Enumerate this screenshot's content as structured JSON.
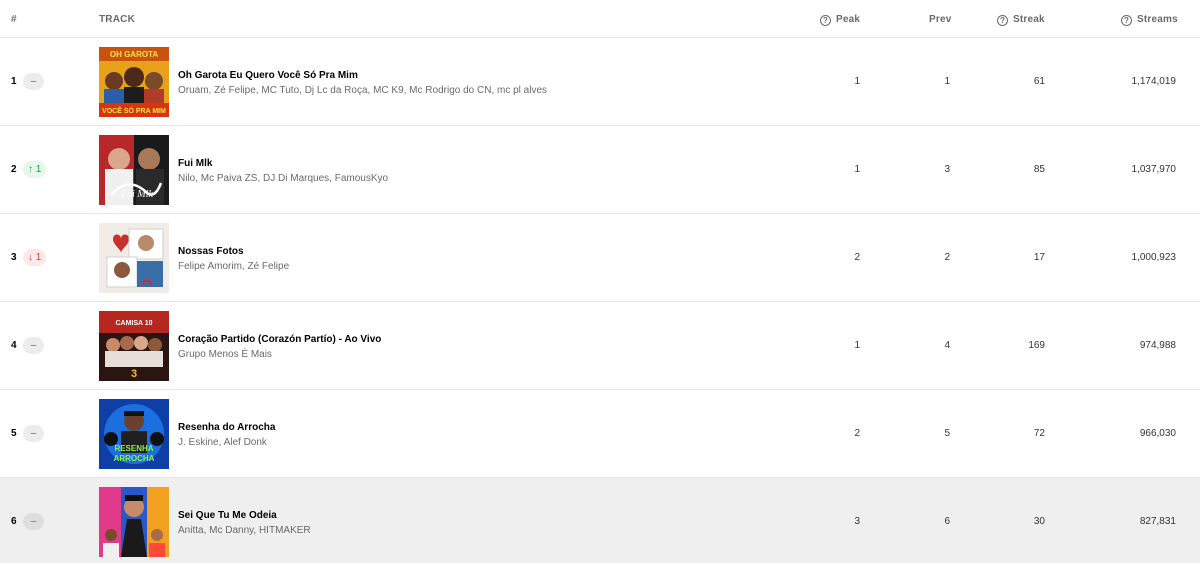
{
  "header": {
    "rank": "#",
    "track": "TRACK",
    "peak": "Peak",
    "prev": "Prev",
    "streak": "Streak",
    "streams": "Streams",
    "help_icon": "?"
  },
  "rows": [
    {
      "rank": "1",
      "change": "–",
      "change_type": "same",
      "title": "Oh Garota Eu Quero Você Só Pra Mim",
      "artists": "Oruam, Zé Felipe, MC Tuto, Dj Lc da Roça, MC K9, Mc Rodrigo do CN, mc pl alves",
      "peak": "1",
      "prev": "1",
      "streak": "61",
      "streams": "1,174,019",
      "cover_lettering": "OH GAROTA / VOCÊ SÓ PRA MIM"
    },
    {
      "rank": "2",
      "change": "↑ 1",
      "change_type": "up",
      "title": "Fui Mlk",
      "artists": "Nilo, Mc Paiva ZS, DJ Di Marques, FamousKyo",
      "peak": "1",
      "prev": "3",
      "streak": "85",
      "streams": "1,037,970",
      "cover_lettering": "Fui Mlk"
    },
    {
      "rank": "3",
      "change": "↓ 1",
      "change_type": "down",
      "title": "Nossas Fotos",
      "artists": "Felipe Amorim, Zé Felipe",
      "peak": "2",
      "prev": "2",
      "streak": "17",
      "streams": "1,000,923",
      "cover_lettering": ""
    },
    {
      "rank": "4",
      "change": "–",
      "change_type": "same",
      "title": "Coração Partido (Corazón Partío) - Ao Vivo",
      "artists": "Grupo Menos É Mais",
      "peak": "1",
      "prev": "4",
      "streak": "169",
      "streams": "974,988",
      "cover_lettering": "3"
    },
    {
      "rank": "5",
      "change": "–",
      "change_type": "same",
      "title": "Resenha do Arrocha",
      "artists": "J. Eskine, Alef Donk",
      "peak": "2",
      "prev": "5",
      "streak": "72",
      "streams": "966,030",
      "cover_lettering": "RESENHA ARROCHA"
    },
    {
      "rank": "6",
      "change": "–",
      "change_type": "same",
      "title": "Sei Que Tu Me Odeia",
      "artists": "Anitta, Mc Danny, HITMAKER",
      "peak": "3",
      "prev": "6",
      "streak": "30",
      "streams": "827,831",
      "cover_lettering": ""
    }
  ],
  "colors": {
    "up": "#1e9c4a",
    "down": "#d33a3a",
    "muted_text": "#6a6a6a",
    "highlight_row": "#efefef",
    "divider": "#e5e5e5"
  }
}
